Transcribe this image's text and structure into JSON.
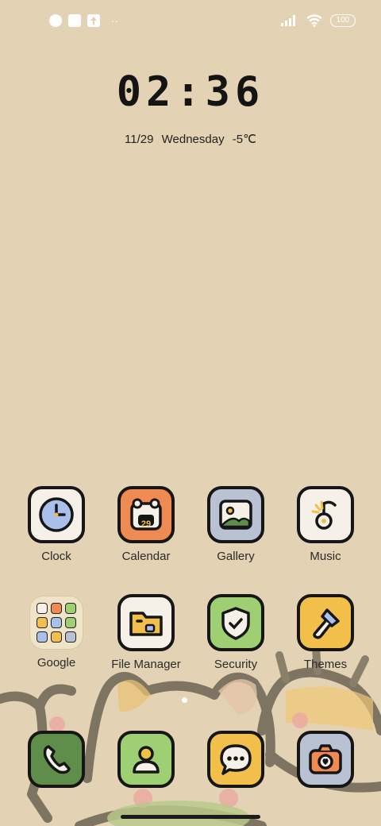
{
  "status_bar": {
    "battery": "100",
    "icons": [
      "app-notification-icon",
      "square-notification-icon",
      "upload-notification-icon",
      "more-dots-icon",
      "signal-icon",
      "wifi-icon",
      "battery-icon"
    ]
  },
  "lockscreen_widget": {
    "time": "02:36",
    "date": "11/29",
    "weekday": "Wednesday",
    "temperature": "-5℃"
  },
  "apps_row1": [
    {
      "label": "Clock",
      "icon": "clock-icon",
      "color": "#f6f1e8"
    },
    {
      "label": "Calendar",
      "icon": "calendar-icon",
      "color": "#ef8a52"
    },
    {
      "label": "Gallery",
      "icon": "gallery-icon",
      "color": "#b9c2d3"
    },
    {
      "label": "Music",
      "icon": "music-icon",
      "color": "#f6f1e8"
    }
  ],
  "apps_row2": [
    {
      "label": "Google",
      "icon": "folder-icon"
    },
    {
      "label": "File Manager",
      "icon": "folder-file-icon",
      "color": "#f6f1e8"
    },
    {
      "label": "Security",
      "icon": "shield-icon",
      "color": "#9ecf73"
    },
    {
      "label": "Themes",
      "icon": "paint-brush-icon",
      "color": "#f2c04a"
    }
  ],
  "calendar_day": "29",
  "dock": [
    {
      "name": "phone",
      "icon": "phone-icon",
      "color": "#5e8e4a"
    },
    {
      "name": "contacts",
      "icon": "contacts-icon",
      "color": "#9ecf73"
    },
    {
      "name": "messages",
      "icon": "message-icon",
      "color": "#f2c04a"
    },
    {
      "name": "camera",
      "icon": "camera-icon",
      "color": "#b9c2d3"
    }
  ],
  "colors": {
    "wallpaper": "#e3d3b4",
    "outline": "#161616"
  }
}
